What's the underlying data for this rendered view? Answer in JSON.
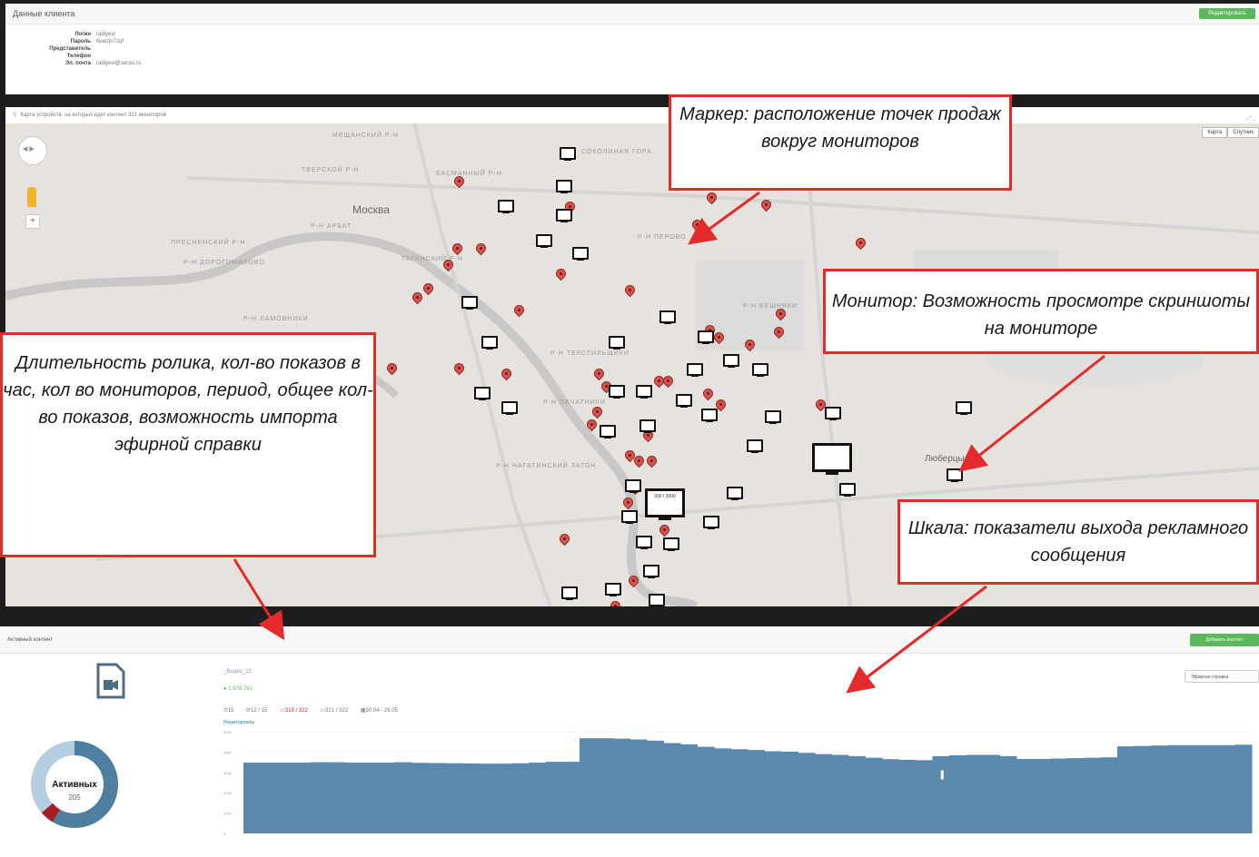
{
  "client": {
    "header": "Данные клиента",
    "edit_button": "Редактировать",
    "fields": [
      {
        "label": "Логин",
        "value": "radiyevi"
      },
      {
        "label": "Пароль",
        "value": "Nuezjn7zqf"
      },
      {
        "label": "Представитель",
        "value": ""
      },
      {
        "label": "Телефон",
        "value": ""
      },
      {
        "label": "Эл. почта",
        "value": "radiyevi@servis.ru"
      }
    ]
  },
  "map": {
    "bar_text": "Карта устройств, на которых идет контент 321 мониторов",
    "type_buttons": [
      "Карта",
      "Спутник"
    ],
    "city_label": "Москва",
    "district_labels": [
      "МЕЩАНСКИЙ Р-Н",
      "ТВЕРСКОЙ Р-Н",
      "БАСМАННЫЙ Р-Н",
      "Р-Н АРБАТ",
      "ПРЕСНЕНСКИЙ Р-Н",
      "Р-Н ДОРОГОМИЛОВО",
      "ТАГАНСКИЙ Р-Н",
      "Р-Н ХАМОВНИКИ",
      "Р-Н ТЕКСТИЛЬЩИКИ",
      "Р-Н ПЕЧАТНИКИ",
      "Р-Н НАГАТИНСКИЙ ЗАТОН",
      "Р-Н ПЕРОВО",
      "Р-Н ВЕШНЯКИ",
      "Люберцы",
      "СОКОЛИНАЯ ГОРА"
    ],
    "big_monitor_text": "300 / 3000"
  },
  "content": {
    "header": "Активный контент",
    "add_button": "Добавить контент",
    "ad_title": "_Видео_15",
    "ad_value": "● 1 678 791",
    "stats": [
      "15",
      "12 / 15",
      "318 / 322",
      "321 / 322",
      "30.04 - 26.05"
    ],
    "edit_link": "Редактировать",
    "dropdown": "Эфирная справка",
    "donut_title": "Активных",
    "donut_count": "205"
  },
  "chart_data": {
    "type": "area",
    "title": "",
    "xlabel": "",
    "ylabel": "",
    "ylim": [
      0,
      5000
    ],
    "y_ticks": [
      "5000",
      "4000",
      "3000",
      "2000",
      "1000",
      "0"
    ],
    "values": [
      3480,
      3480,
      3480,
      3480,
      3500,
      3500,
      3480,
      3480,
      3480,
      3500,
      3470,
      3460,
      3450,
      3440,
      3430,
      3430,
      3450,
      3480,
      3520,
      3520,
      4680,
      4680,
      4660,
      4620,
      4560,
      4440,
      4380,
      4260,
      4180,
      4140,
      4100,
      4040,
      4020,
      3960,
      3900,
      3860,
      3800,
      3720,
      3650,
      3620,
      3600,
      3800,
      3840,
      3860,
      3860,
      3800,
      3660,
      3660,
      3680,
      3700,
      3720,
      3740,
      4280,
      4300,
      4320,
      4340,
      4340,
      4340,
      4340,
      4360
    ]
  },
  "callouts": {
    "marker": "Маркер: расположение точек продаж вокруг мониторов",
    "monitor": "Монитор: Возможность просмотре скриншоты на мониторе",
    "duration": "Длительность ролика, кол-во показов в час, кол во мониторов, период, общее кол-во показов, возможность импорта эфирной справки",
    "scale": "Шкала: показатели выхода рекламного сообщения"
  },
  "colors": {
    "chart_fill": "#5b88ad",
    "marker": "#d9534f",
    "callout_border": "#e32b2b",
    "button_green": "#5cb85c"
  }
}
